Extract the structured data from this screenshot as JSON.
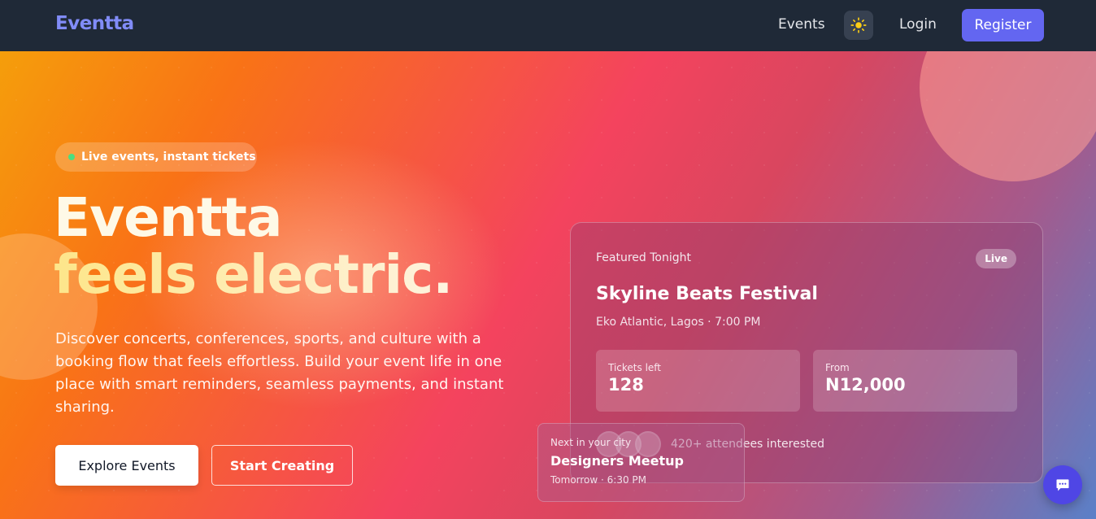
{
  "nav": {
    "brand": "Eventta",
    "events_link": "Events",
    "theme_icon": "sun-icon",
    "login_link": "Login",
    "register_button": "Register"
  },
  "hero": {
    "pill": "Live events, instant tickets",
    "headline_line1": "Eventta",
    "headline_line2": "feels electric.",
    "description": "Discover concerts, conferences, sports, and culture with a booking flow that feels effortless. Build your event life in one place with smart reminders, seamless payments, and instant sharing.",
    "primary_button": "Explore Events",
    "secondary_button": "Start Creating"
  },
  "featured": {
    "eyebrow": "Featured Tonight",
    "badge": "Live",
    "title": "Skyline Beats Festival",
    "subtitle": "Eko Atlantic, Lagos · 7:00 PM",
    "stats": [
      {
        "label": "Tickets left",
        "value": "128"
      },
      {
        "label": "From",
        "value": "N12,000"
      }
    ],
    "interest": "420+ attendees interested"
  },
  "next_event": {
    "eyebrow": "Next in your city",
    "title": "Designers Meetup",
    "subtitle": "Tomorrow · 6:30 PM"
  },
  "chat": {
    "icon": "chat-icon"
  },
  "colors": {
    "brand": "#818cf8",
    "register": "#6366f1",
    "live_dot": "#4ade80",
    "chat": "#4f46e5"
  }
}
